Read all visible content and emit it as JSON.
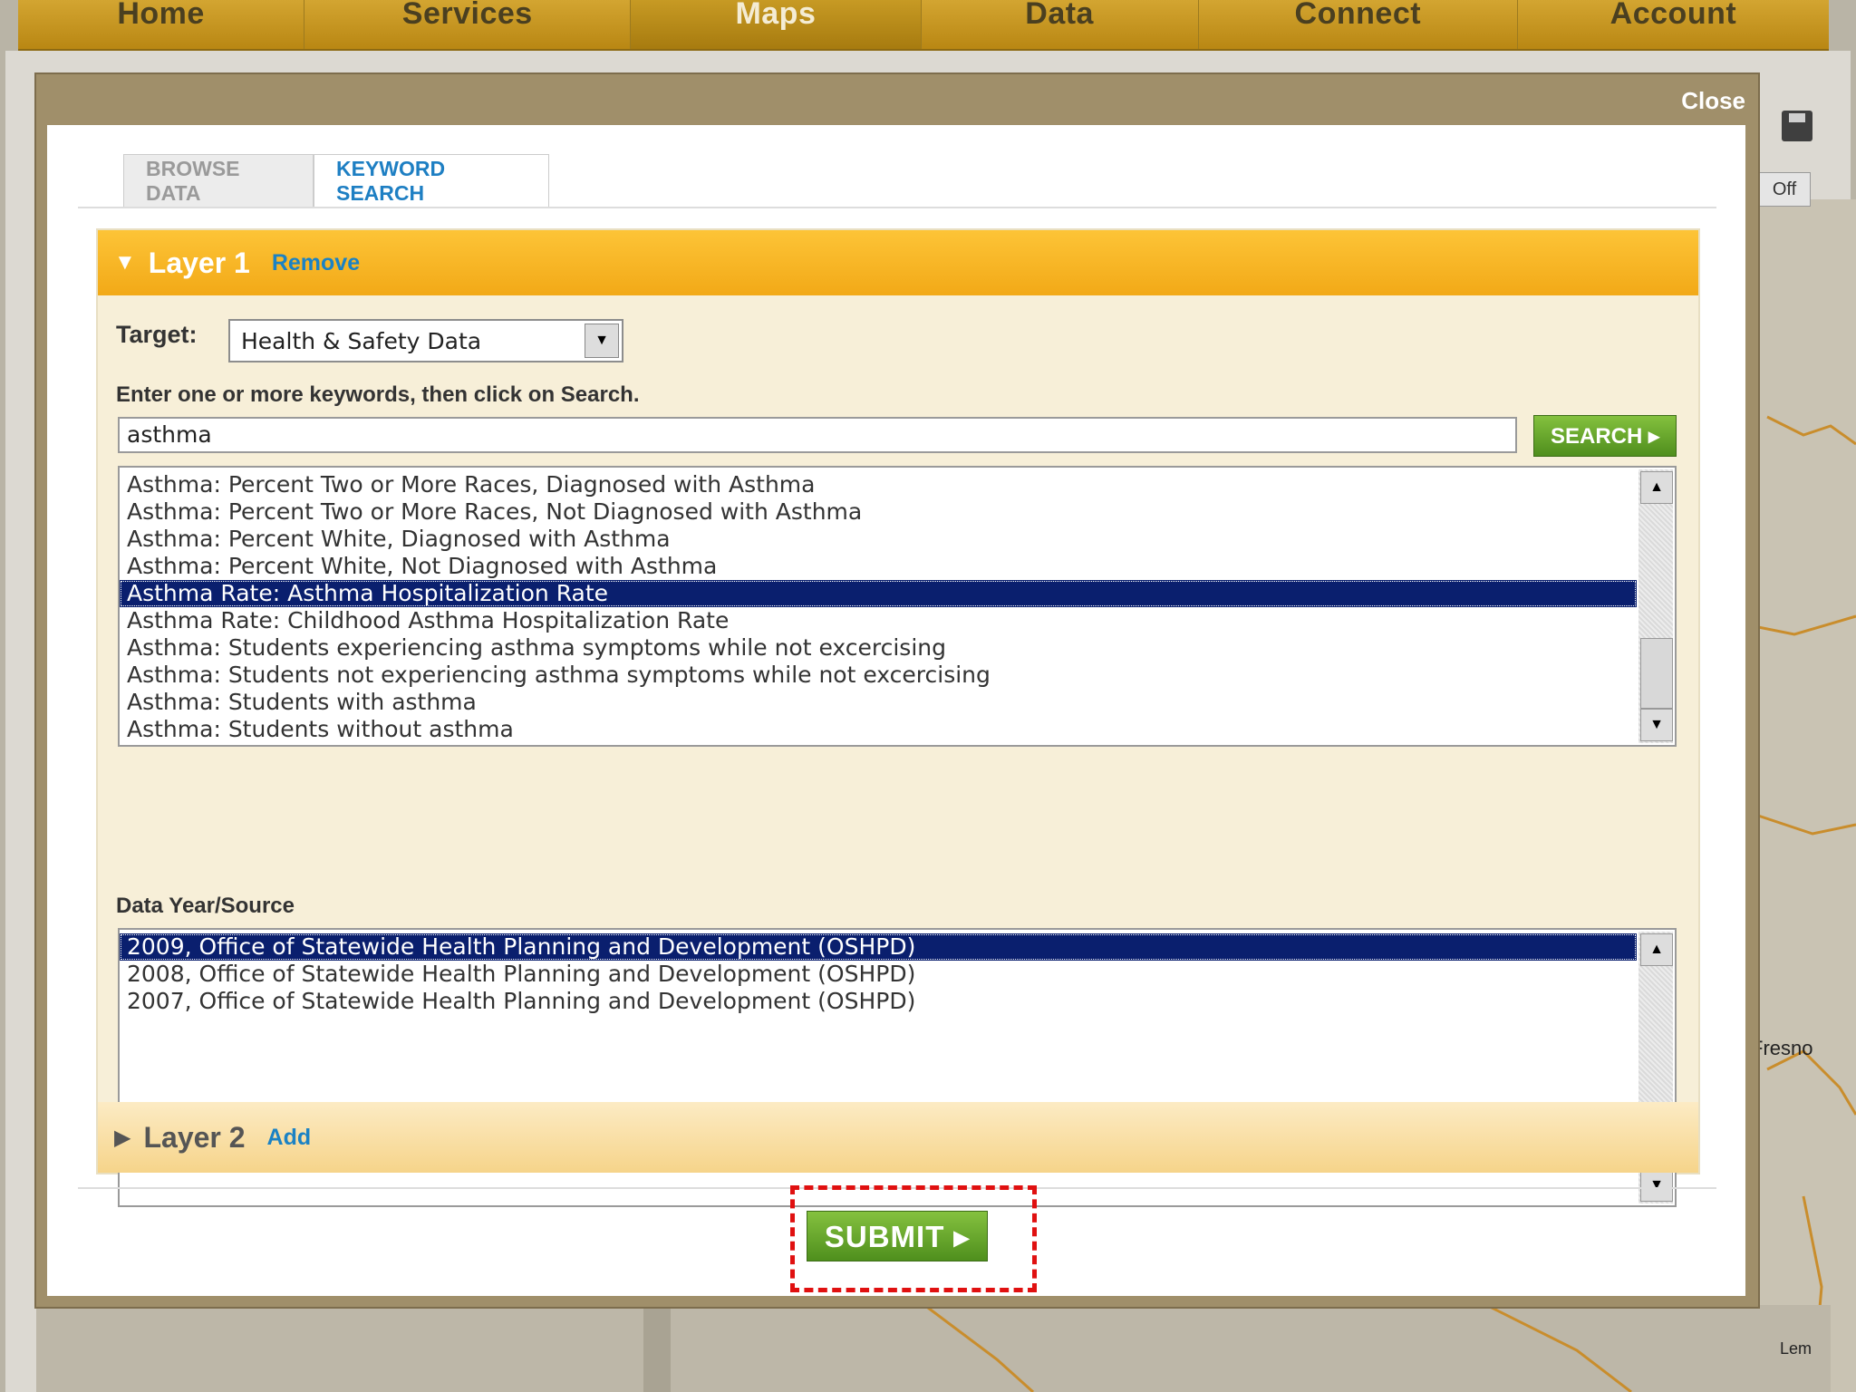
{
  "nav": {
    "items": [
      "Home",
      "Services",
      "Maps",
      "Data",
      "Connect",
      "Account"
    ],
    "active": "Maps"
  },
  "background": {
    "off_label": "Off",
    "map_labels": {
      "fresno": "Fresno",
      "lem": "Lem"
    }
  },
  "modal": {
    "close_label": "Close",
    "tabs": [
      {
        "label": "BROWSE DATA",
        "active": false
      },
      {
        "label": "KEYWORD SEARCH",
        "active": true
      }
    ],
    "layer1": {
      "title": "Layer 1",
      "remove_label": "Remove",
      "target_label": "Target:",
      "target_value": "Health & Safety Data",
      "instructions": "Enter one or more keywords, then click on Search.",
      "keyword_value": "asthma",
      "search_label": "SEARCH ▸",
      "results": [
        "Asthma: Percent Two or More Races, Diagnosed with Asthma",
        "Asthma: Percent Two or More Races, Not Diagnosed with Asthma",
        "Asthma: Percent White, Diagnosed with Asthma",
        "Asthma: Percent White, Not Diagnosed with Asthma",
        "Asthma Rate: Asthma Hospitalization Rate",
        "Asthma Rate: Childhood Asthma Hospitalization Rate",
        "Asthma: Students experiencing asthma symptoms while not excercising",
        "Asthma: Students not experiencing asthma symptoms while not excercising",
        "Asthma: Students with asthma",
        "Asthma: Students without asthma"
      ],
      "selected_result_index": 4,
      "data_year_label": "Data Year/Source",
      "sources": [
        "2009, Office of Statewide Health Planning and Development (OSHPD)",
        "2008, Office of Statewide Health Planning and Development (OSHPD)",
        "2007, Office of Statewide Health Planning and Development (OSHPD)"
      ],
      "selected_source_index": 0
    },
    "layer2": {
      "title": "Layer 2",
      "add_label": "Add"
    },
    "submit_label": "SUBMIT ▸"
  },
  "colors": {
    "nav_gold": "#c79a24",
    "layer_header": "#f9b928",
    "selection_blue": "#0a1f6e",
    "link_blue": "#1b82c4",
    "button_green": "#5fa02a",
    "highlight_red": "#e01010"
  }
}
